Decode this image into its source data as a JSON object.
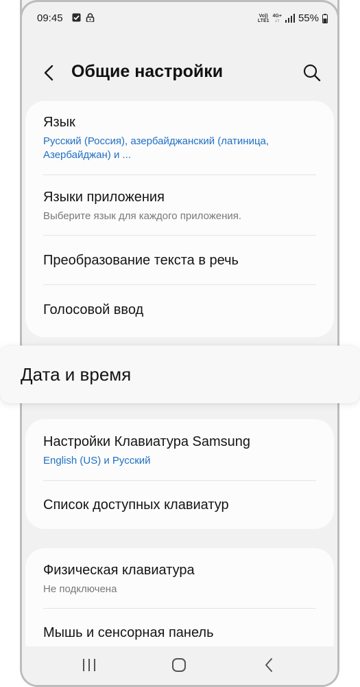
{
  "status_bar": {
    "time": "09:45",
    "left_icons": [
      "checkbox-notification-icon",
      "lock-icon"
    ],
    "network_top": "Vo))",
    "network_bottom": "LTE1",
    "data_top": "4G+",
    "battery": "55%"
  },
  "header": {
    "title": "Общие настройки",
    "back_icon": "chevron-left-icon",
    "search_icon": "search-icon"
  },
  "section1": [
    {
      "title": "Язык",
      "subtitle": "Русский (Россия), азербайджанский (латиница, Азербайджан) и ...",
      "subtitle_style": "blue"
    },
    {
      "title": "Языки приложения",
      "subtitle": "Выберите язык для каждого приложения.",
      "subtitle_style": "gray"
    },
    {
      "title": "Преобразование текста в речь"
    },
    {
      "title": "Голосовой ввод"
    }
  ],
  "highlight": {
    "title": "Дата и время"
  },
  "section2": [
    {
      "title": "Настройки Клавиатура Samsung",
      "subtitle": "English (US) и Русский",
      "subtitle_style": "blue"
    },
    {
      "title": "Список доступных клавиатур"
    }
  ],
  "section3": [
    {
      "title": "Физическая клавиатура",
      "subtitle": "Не подключена",
      "subtitle_style": "gray"
    },
    {
      "title": "Мышь и сенсорная панель"
    }
  ],
  "navigation": {
    "recent_icon": "recent-apps-icon",
    "home_icon": "home-icon",
    "back_icon": "back-icon"
  },
  "colors": {
    "accent_blue": "#1f6fc5",
    "subtitle_gray": "#787878",
    "background": "#f1f1f1",
    "card": "#fcfcfc"
  }
}
